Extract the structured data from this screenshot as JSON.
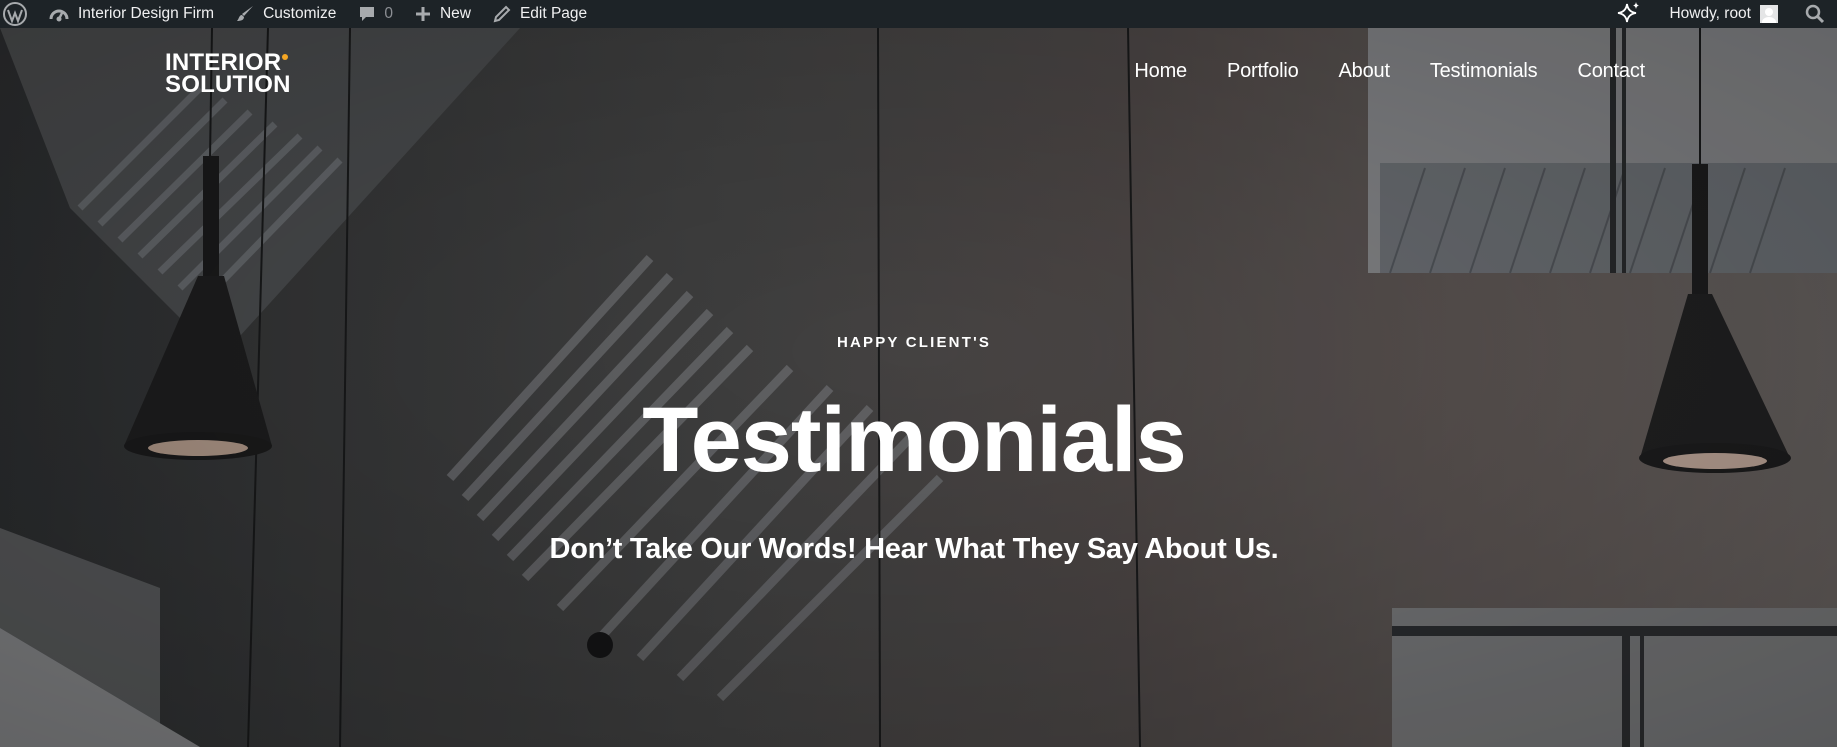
{
  "admin_bar": {
    "site_name": "Interior Design Firm",
    "customize": "Customize",
    "comments_count": "0",
    "new": "New",
    "edit_page": "Edit Page",
    "greeting": "Howdy, root"
  },
  "header": {
    "logo_line1": "INTERIOR",
    "logo_line2": "SOLUTION",
    "logo_dot_color": "#f5a623",
    "nav": [
      "Home",
      "Portfolio",
      "About",
      "Testimonials",
      "Contact"
    ]
  },
  "hero": {
    "eyebrow": "HAPPY CLIENT'S",
    "title": "Testimonials",
    "subtitle": "Don’t Take Our Words! Hear What They Say About Us."
  }
}
